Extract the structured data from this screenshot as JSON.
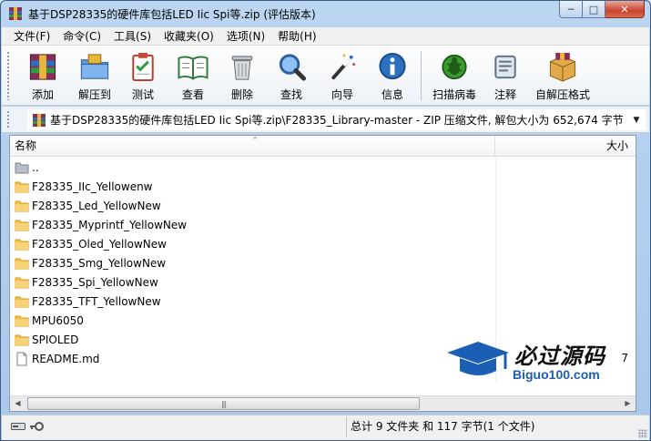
{
  "window": {
    "title": "基于DSP28335的硬件库包括LED Iic Spi等.zip (评估版本)",
    "minimize_glyph": "─",
    "maximize_glyph": "□",
    "close_glyph": "✕"
  },
  "menu": [
    {
      "label": "文件(F)"
    },
    {
      "label": "命令(C)"
    },
    {
      "label": "工具(S)"
    },
    {
      "label": "收藏夹(O)"
    },
    {
      "label": "选项(N)"
    },
    {
      "label": "帮助(H)"
    }
  ],
  "toolbar": {
    "add": "添加",
    "extract_to": "解压到",
    "test": "测试",
    "view": "查看",
    "delete": "删除",
    "find": "查找",
    "wizard": "向导",
    "info": "信息",
    "scan_virus": "扫描病毒",
    "comment": "注释",
    "sfx": "自解压格式"
  },
  "address": {
    "path": "基于DSP28335的硬件库包括LED Iic Spi等.zip\\F28335_Library-master - ZIP 压缩文件, 解包大小为 652,674 字节",
    "dropdown_glyph": "▼"
  },
  "list": {
    "col_name": "名称",
    "col_size": "大小",
    "sort_glyph": "^",
    "rows": [
      {
        "name": "..",
        "size": "",
        "icon": "up-folder-icon"
      },
      {
        "name": "F28335_IIc_Yellowenw",
        "size": "",
        "icon": "folder-icon"
      },
      {
        "name": "F28335_Led_YellowNew",
        "size": "",
        "icon": "folder-icon"
      },
      {
        "name": "F28335_Myprintf_YellowNew",
        "size": "",
        "icon": "folder-icon"
      },
      {
        "name": "F28335_Oled_YellowNew",
        "size": "",
        "icon": "folder-icon"
      },
      {
        "name": "F28335_Smg_YellowNew",
        "size": "",
        "icon": "folder-icon"
      },
      {
        "name": "F28335_Spi_YellowNew",
        "size": "",
        "icon": "folder-icon"
      },
      {
        "name": "F28335_TFT_YellowNew",
        "size": "",
        "icon": "folder-icon"
      },
      {
        "name": "MPU6050",
        "size": "",
        "icon": "folder-icon"
      },
      {
        "name": "SPIOLED",
        "size": "",
        "icon": "folder-icon"
      },
      {
        "name": "README.md",
        "size": "7",
        "icon": "file-icon"
      }
    ]
  },
  "scrollbar": {
    "left_glyph": "◀",
    "right_glyph": "▶",
    "thumb_glyph": "|||"
  },
  "status": {
    "summary": "总计 9 文件夹 和 117 字节(1 个文件)"
  },
  "watermark": {
    "title": "必过源码",
    "subtitle": "Biguo100.com"
  },
  "colors": {
    "folder": "#f2c14e",
    "folder_dark": "#d99a1e",
    "title_bar": "#bcd6f1",
    "watermark_blue": "#1a5fb4"
  }
}
